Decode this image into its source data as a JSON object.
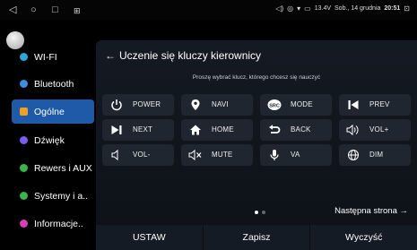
{
  "statusbar": {
    "nav_back": "◁",
    "nav_home": "○",
    "nav_recent": "□",
    "notification": "⊞",
    "voltage": "13.4V",
    "date": "Sob., 14 grudnia",
    "time": "20:51"
  },
  "sidebar": {
    "items": [
      {
        "label": "WI-FI",
        "color": "#2fa7d6"
      },
      {
        "label": "Bluetooth",
        "color": "#3f8fe0"
      },
      {
        "label": "Ogólne",
        "color": "#f0a020"
      },
      {
        "label": "Dźwięk",
        "color": "#7b5cf0"
      },
      {
        "label": "Rewers i AUX",
        "color": "#39b54a"
      },
      {
        "label": "Systemy i a..",
        "color": "#39b54a"
      },
      {
        "label": "Informacje..",
        "color": "#d63fb8"
      }
    ],
    "active_index": 2
  },
  "panel": {
    "title": "Uczenie się kluczy kierownicy",
    "subtitle": "Proszę wybrać klucz, którego chcesz się nauczyć",
    "keys": [
      {
        "label": "POWER",
        "icon": "power-icon"
      },
      {
        "label": "NAVI",
        "icon": "location-pin-icon"
      },
      {
        "label": "MODE",
        "icon": "src-icon",
        "icon_text": "SRC"
      },
      {
        "label": "PREV",
        "icon": "skip-previous-icon"
      },
      {
        "label": "NEXT",
        "icon": "skip-next-icon"
      },
      {
        "label": "HOME",
        "icon": "home-icon"
      },
      {
        "label": "BACK",
        "icon": "back-arrow-icon"
      },
      {
        "label": "VOL+",
        "icon": "volume-up-icon"
      },
      {
        "label": "VOL-",
        "icon": "volume-down-icon"
      },
      {
        "label": "MUTE",
        "icon": "mute-icon"
      },
      {
        "label": "VA",
        "icon": "microphone-icon"
      },
      {
        "label": "DIM",
        "icon": "globe-icon"
      }
    ],
    "page_count": 2,
    "current_page": 1,
    "next_page_label": "Następna strona",
    "buttons": {
      "set": "USTAW",
      "save": "Zapisz",
      "clear": "Wyczyść"
    }
  }
}
